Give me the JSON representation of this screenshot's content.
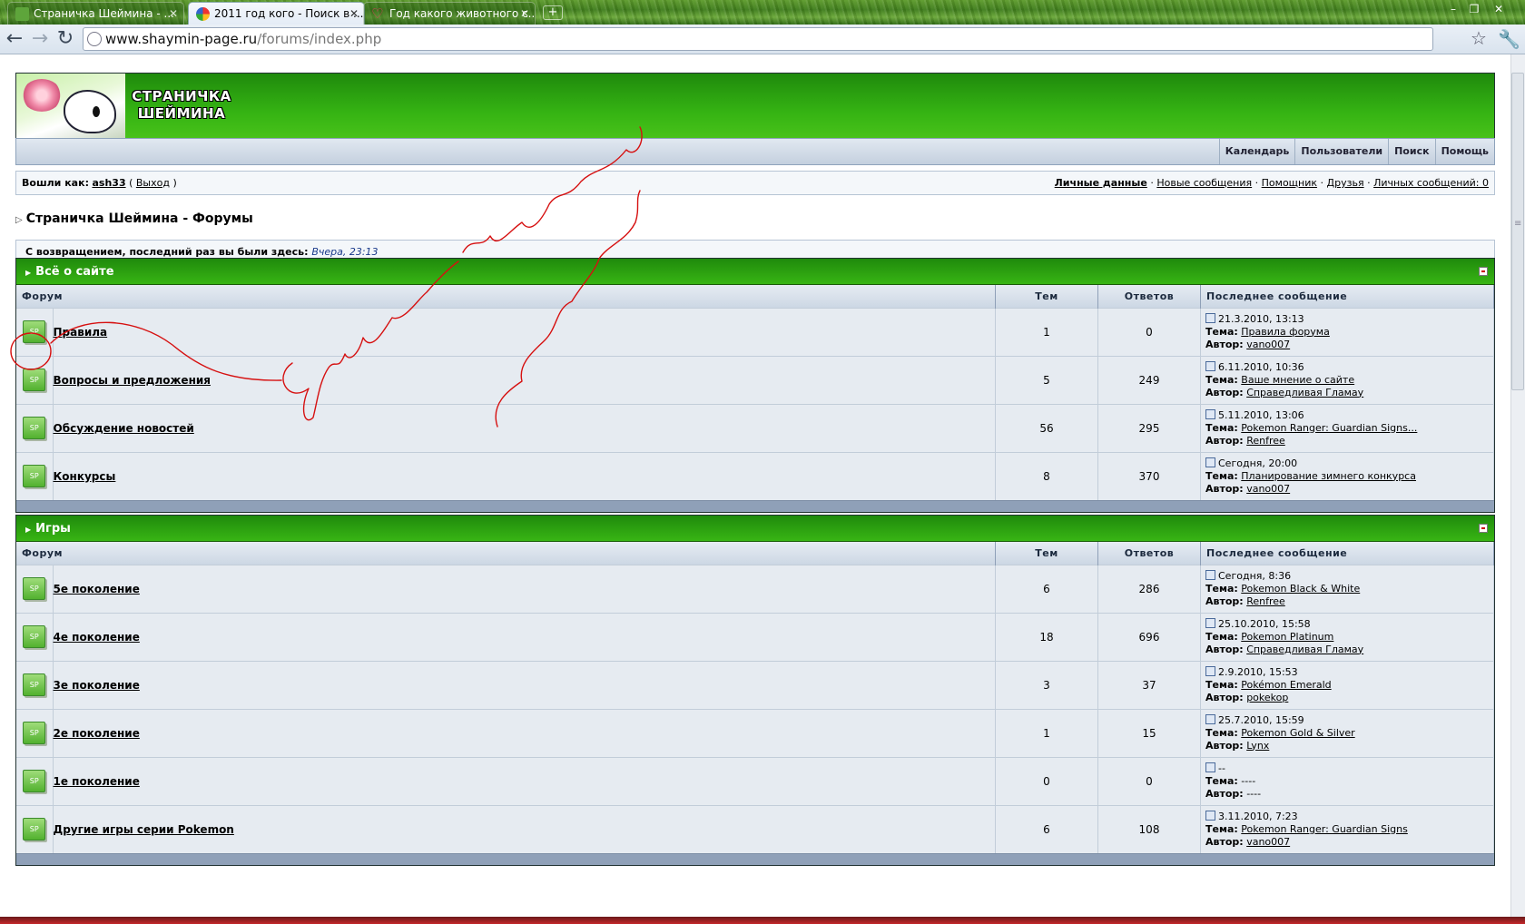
{
  "tabs": [
    {
      "title": "Страничка Шеймина - ...",
      "active": false
    },
    {
      "title": "2011 год кого - Поиск в ...",
      "active": true
    },
    {
      "title": "Год какого животного с...",
      "active": false
    }
  ],
  "address": {
    "host": "www.shaymin-page.ru",
    "path": "/forums/index.php"
  },
  "site": {
    "name_line1": "СТРАНИЧКА",
    "name_line2": "ШЕЙМИНА"
  },
  "nav_links": [
    "Календарь",
    "Пользователи",
    "Поиск",
    "Помощь"
  ],
  "userbar": {
    "logged_label": "Вошли как:",
    "username": "ash33",
    "logout": "Выход",
    "links": [
      "Личные данные",
      "Новые сообщения",
      "Помощник",
      "Друзья",
      "Личных сообщений: 0"
    ]
  },
  "breadcrumb": "Страничка Шеймина - Форумы",
  "welcome": {
    "text": "С возвращением, последний раз вы были здесь:",
    "time": "Вчера, 23:13"
  },
  "columns": {
    "forum": "Форум",
    "topics": "Тем",
    "replies": "Ответов",
    "last": "Последнее сообщение"
  },
  "labels": {
    "topic": "Тема:",
    "author": "Автор:"
  },
  "categories": [
    {
      "title": "Всё о сайте",
      "forums": [
        {
          "name": "Правила",
          "topics": "1",
          "replies": "0",
          "date": "21.3.2010, 13:13",
          "topic": "Правила форума",
          "author": "vano007"
        },
        {
          "name": "Вопросы и предложения",
          "topics": "5",
          "replies": "249",
          "date": "6.11.2010, 10:36",
          "topic": "Ваше мнение о сайте",
          "author": "Справедливая Гламау"
        },
        {
          "name": "Обсуждение новостей",
          "topics": "56",
          "replies": "295",
          "date": "5.11.2010, 13:06",
          "topic": "Pokemon Ranger: Guardian Signs...",
          "author": "Renfree"
        },
        {
          "name": "Конкурсы",
          "topics": "8",
          "replies": "370",
          "date": "Сегодня, 20:00",
          "topic": "Планирование зимнего конкурса",
          "author": "vano007"
        }
      ]
    },
    {
      "title": "Игры",
      "forums": [
        {
          "name": "5е поколение",
          "topics": "6",
          "replies": "286",
          "date": "Сегодня, 8:36",
          "topic": "Pokemon Black & White",
          "author": "Renfree"
        },
        {
          "name": "4е поколение",
          "topics": "18",
          "replies": "696",
          "date": "25.10.2010, 15:58",
          "topic": "Pokemon Platinum",
          "author": "Справедливая Гламау"
        },
        {
          "name": "3е поколение",
          "topics": "3",
          "replies": "37",
          "date": "2.9.2010, 15:53",
          "topic": "Pokémon Emerald",
          "author": "pokekop"
        },
        {
          "name": "2е поколение",
          "topics": "1",
          "replies": "15",
          "date": "25.7.2010, 15:59",
          "topic": "Pokemon Gold & Silver",
          "author": "Lynx"
        },
        {
          "name": "1е поколение",
          "topics": "0",
          "replies": "0",
          "date": "--",
          "topic": "----",
          "author": "----"
        },
        {
          "name": "Другие игры серии Pokemon",
          "topics": "6",
          "replies": "108",
          "date": "3.11.2010, 7:23",
          "topic": "Pokemon Ranger: Guardian Signs",
          "author": "vano007"
        }
      ]
    }
  ],
  "icon_label": "SP",
  "colors": {
    "header_green": "#35b313",
    "annotation_red": "#d61010",
    "row_bg": "#e6ebf1"
  }
}
